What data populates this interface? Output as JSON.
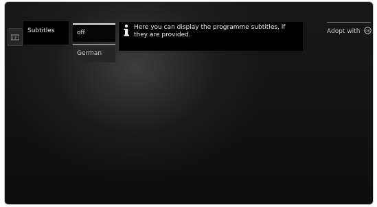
{
  "menu": {
    "current_item": "Subtitles"
  },
  "options": [
    {
      "label": "off",
      "selected": true
    },
    {
      "label": "German",
      "selected": false
    }
  ],
  "info": {
    "icon": "info-icon",
    "text": "Here you can display the programme subtitles, if they are provided."
  },
  "hint": {
    "label": "Adopt with",
    "icon": "ok-button-icon"
  }
}
